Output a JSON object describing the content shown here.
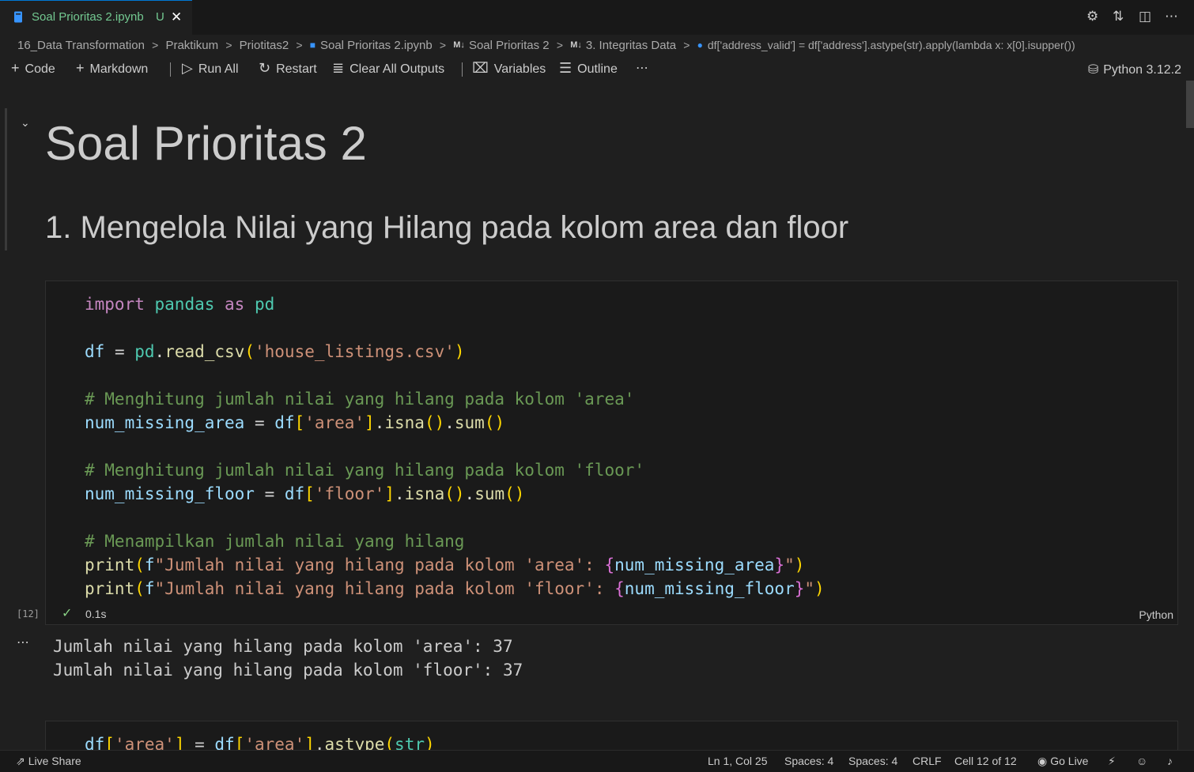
{
  "tab": {
    "label": "Soal Prioritas 2.ipynb",
    "modified": "U",
    "close": "✕"
  },
  "breadcrumb": [
    "16_Data Transformation",
    "Praktikum",
    "Priotitas2",
    "Soal Prioritas 2.ipynb",
    "Soal Prioritas 2",
    "3. Integritas Data",
    "df['address_valid'] = df['address'].astype(str).apply(lambda x: x[0].isupper())"
  ],
  "toolbar": {
    "code": "Code",
    "markdown": "Markdown",
    "run_all": "Run All",
    "restart": "Restart",
    "clear_outputs": "Clear All Outputs",
    "variables": "Variables",
    "outline": "Outline",
    "more": "⋯",
    "kernel": "Python 3.12.2"
  },
  "notebook": {
    "title": "Soal Prioritas 2",
    "section": "1. Mengelola Nilai yang Hilang pada kolom area dan floor",
    "cell": {
      "exec_count": "[12]",
      "duration": "0.1s",
      "language": "Python"
    },
    "output_lines": [
      "Jumlah nilai yang hilang pada kolom 'area': 37",
      "Jumlah nilai yang hilang pada kolom 'floor': 37"
    ]
  },
  "statusbar": {
    "live_share": "Live Share",
    "position": "Ln 1, Col 25",
    "spaces1": "Spaces: 4",
    "spaces2": "Spaces: 4",
    "eol": "CRLF",
    "cell": "Cell 12 of 12",
    "go_live": "Go Live"
  }
}
